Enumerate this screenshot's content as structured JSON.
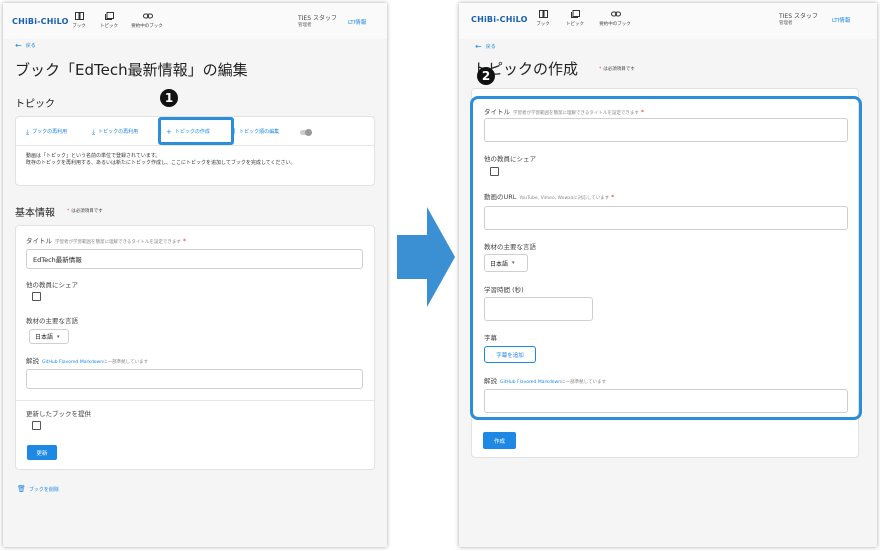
{
  "nav": {
    "logo": "CHiBi-CHiLO",
    "items": [
      {
        "label": "ブック",
        "icon": "book-icon"
      },
      {
        "label": "トピック",
        "icon": "topic-icon"
      },
      {
        "label": "要約中のブック",
        "icon": "link-icon"
      }
    ],
    "user_name": "TIES スタッフ",
    "user_role": "管理者",
    "lti": "LTI情報"
  },
  "left": {
    "back": "戻る",
    "title": "ブック「EdTech最新情報」の編集",
    "topic_heading": "トピック",
    "toolbar": {
      "reuse_book": "ブックの再利用",
      "reuse_topic": "トピックの再利用",
      "create_topic": "トピックの作成",
      "edit_topic_order": "トピック順の編集"
    },
    "topic_desc_1": "動画は「トピック」という名前の単位で登録されています。",
    "topic_desc_2": "既存のトピックを再利用する、あるいは新たにトピック作成し、ここにトピックを追加してブックを完成してください。",
    "basic_heading": "基本情報",
    "required_note": "は必須項目です",
    "form": {
      "title_label": "タイトル",
      "title_hint": "学習者が学習範囲を簡潔に理解できるタイトルを設定できます",
      "title_value": "EdTech最新情報",
      "share_label": "他の教員にシェア",
      "language_label": "教材の主要な言語",
      "language_value": "日本語",
      "desc_label": "解説",
      "desc_link": "GitHub Flavored Markdown",
      "desc_hint": "に一部準拠しています",
      "provide_label": "更新したブックを提供",
      "update_button": "更新"
    },
    "delete": "ブックを削除"
  },
  "right": {
    "back": "戻る",
    "title": "トピックの作成",
    "required_note": "は必須項目です",
    "form": {
      "title_label": "タイトル",
      "title_hint": "学習者が学習範囲を簡潔に理解できるタイトルを設定できます",
      "share_label": "他の教員にシェア",
      "url_label": "動画のURL",
      "url_hint": "YouTube, Vimeo, Wowzaに対応しています",
      "language_label": "教材の主要な言語",
      "language_value": "日本語",
      "time_label": "学習時間 (秒)",
      "subtitle_label": "字幕",
      "subtitle_button": "字幕を追加",
      "desc_label": "解説",
      "desc_link": "GitHub Flavored Markdown",
      "desc_hint": "に一部準拠しています",
      "create_button": "作成"
    }
  },
  "annotations": {
    "badge_1": "1",
    "badge_2": "2"
  },
  "colors": {
    "accent": "#1e88e5",
    "highlight": "#2a8ed8",
    "arrow": "#3b8fd3",
    "required": "#e53935"
  }
}
